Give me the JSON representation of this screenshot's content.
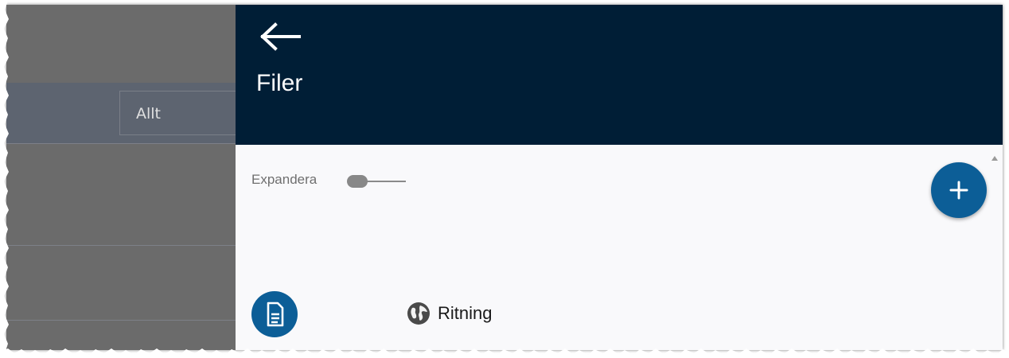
{
  "background": {
    "filter_value": "Allt"
  },
  "drawer": {
    "title": "Filer",
    "back_icon": "arrow-left-icon",
    "expand_label": "Expandera",
    "expand_toggle_on": false,
    "add_icon": "plus-icon",
    "header_color": "#001e36",
    "accent_color": "#0c5e97",
    "file_item": {
      "icon": "document-icon",
      "type_icon": "globe-icon",
      "label": "Ritning"
    }
  }
}
